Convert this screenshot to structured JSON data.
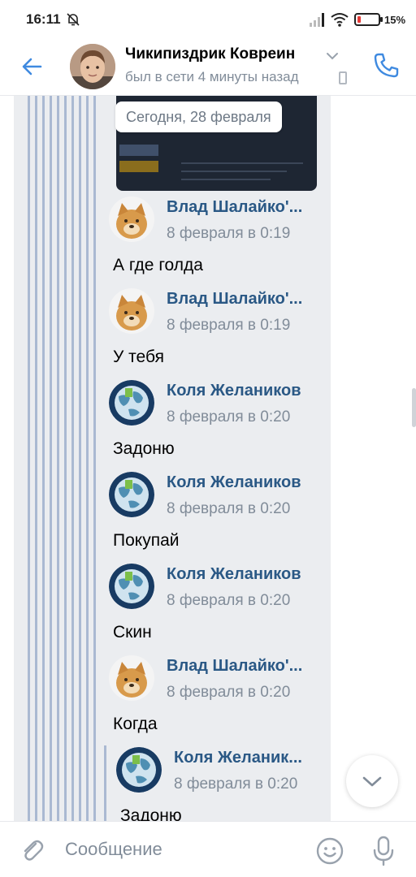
{
  "status_bar": {
    "time": "16:11",
    "battery_text": "15%",
    "battery_level": 0.15,
    "icons": [
      "notifications-off-icon",
      "signal-icon",
      "wifi-icon",
      "battery-icon"
    ]
  },
  "header": {
    "contact_name": "Чикипиздрик Ковреин",
    "last_seen": "был в сети 4 минуты назад",
    "icons": [
      "back-arrow-icon",
      "chevron-down-icon",
      "phone-icon",
      "call-icon"
    ]
  },
  "chat": {
    "date_separator": "Сегодня, 28 февраля",
    "messages": [
      {
        "author": "Влад Шалайко'...",
        "date": "8 февраля в 0:19",
        "text": "А где голда",
        "avatar": "cheems-dog-avatar"
      },
      {
        "author": "Влад Шалайко'...",
        "date": "8 февраля в 0:19",
        "text": "У тебя",
        "avatar": "cheems-dog-avatar"
      },
      {
        "author": "Коля Желаников",
        "date": "8 февраля в 0:20",
        "text": "Задоню",
        "avatar": "globe-avatar"
      },
      {
        "author": "Коля Желаников",
        "date": "8 февраля в 0:20",
        "text": "Покупай",
        "avatar": "globe-avatar"
      },
      {
        "author": "Коля Желаников",
        "date": "8 февраля в 0:20",
        "text": "Скин",
        "avatar": "globe-avatar"
      },
      {
        "author": "Влад Шалайко'...",
        "date": "8 февраля в 0:20",
        "text": "Когда",
        "avatar": "cheems-dog-avatar"
      },
      {
        "author": "Коля Желаник...",
        "date": "8 февраля в 0:20",
        "text": "Задоню",
        "avatar": "globe-avatar"
      }
    ]
  },
  "composer": {
    "placeholder": "Сообщение",
    "value": "",
    "icons": [
      "attach-icon",
      "emoji-icon",
      "microphone-icon"
    ]
  },
  "colors": {
    "accent": "#2a5885",
    "icon_blue": "#3f8ae0",
    "muted_text": "#818c99",
    "rail_background": "#ebedf0",
    "quote_line": "#aab9d2",
    "battery_low": "#e53935"
  }
}
